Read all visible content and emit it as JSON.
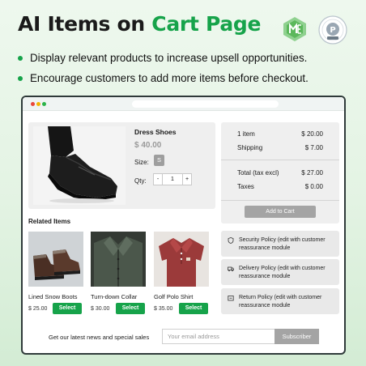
{
  "header": {
    "title_part1": "AI Items on",
    "title_part2": "Cart Page",
    "accent_color": "#16a34a",
    "logos": [
      "me-logo-icon",
      "prestashop-partner-badge-icon"
    ]
  },
  "bullets": [
    "Display relevant products to increase upsell opportunities.",
    "Encourage customers to add more items before checkout."
  ],
  "product": {
    "name": "Dress Shoes",
    "price": "$ 40.00",
    "size_label": "Size:",
    "size_value": "S",
    "qty_label": "Qty:",
    "qty_minus": "-",
    "qty_value": "1",
    "qty_plus": "+"
  },
  "summary": {
    "rows": [
      {
        "label": "1 item",
        "value": "$ 20.00"
      },
      {
        "label": "Shipping",
        "value": "$ 7.00"
      },
      {
        "label": "Total (tax excl)",
        "value": "$ 27.00"
      },
      {
        "label": "Taxes",
        "value": "$ 0.00"
      }
    ],
    "add_to_cart": "Add to Cart"
  },
  "related": {
    "title": "Related Items",
    "items": [
      {
        "name": "Lined Snow Boots",
        "price": "$ 25.00",
        "button": "Select"
      },
      {
        "name": "Turn-down Collar",
        "price": "$ 30.00",
        "button": "Select"
      },
      {
        "name": "Golf Polo Shirt",
        "price": "$ 35.00",
        "button": "Select"
      }
    ]
  },
  "reassurance": [
    {
      "icon": "shield-icon",
      "text": "Security Policy (edit with customer reassurance module"
    },
    {
      "icon": "truck-icon",
      "text": "Delivery Policy (edit with customer reassurance module"
    },
    {
      "icon": "return-icon",
      "text": "Return Policy (edit with customer reassurance module"
    }
  ],
  "newsletter": {
    "label": "Get our latest news and special sales",
    "placeholder": "Your email address",
    "button": "Subscriber"
  }
}
